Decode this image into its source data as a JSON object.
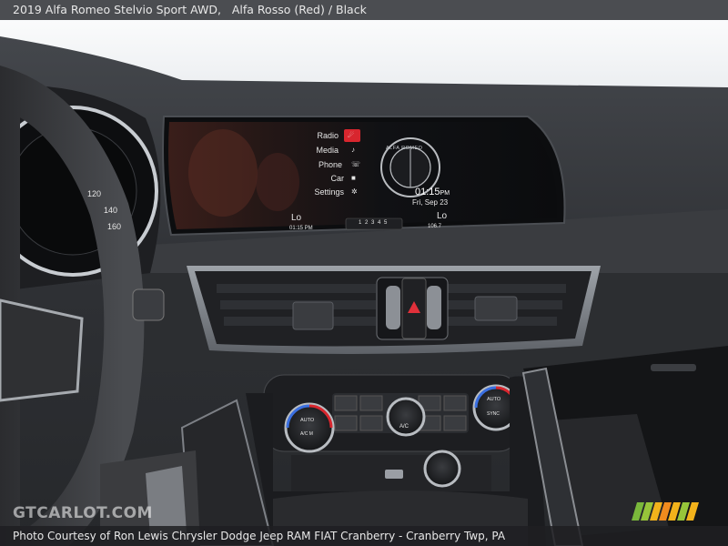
{
  "caption": {
    "title": "2019 Alfa Romeo Stelvio Sport AWD,",
    "color": "Alfa Rosso (Red)  /  Black"
  },
  "footer": {
    "credit": "Photo Courtesy of Ron Lewis Chrysler Dodge Jeep RAM FIAT Cranberry - Cranberry Twp, PA",
    "watermark": "GTCARLOT.COM"
  },
  "infotainment": {
    "menu": [
      "Radio",
      "Media",
      "Phone",
      "Car",
      "Settings"
    ],
    "active_menu_color": "#d8262e",
    "logo_text": "ALFA ROMEO",
    "clock": "01:15",
    "clock_suffix": "PM",
    "date": "Fri, Sep 23",
    "left_temp": "Lo",
    "right_temp": "Lo",
    "left_bottom": "01:15 PM",
    "right_bottom": "106.7",
    "presets": "1 2 3 4 5"
  },
  "gauge": {
    "ticks": [
      "120",
      "140",
      "160"
    ]
  },
  "climate": {
    "left_knob": "AUTO",
    "left_knob_sub": "A/C M",
    "center_knob": "A/C",
    "right_knob": "AUTO",
    "right_knob_sub": "SYNC"
  }
}
